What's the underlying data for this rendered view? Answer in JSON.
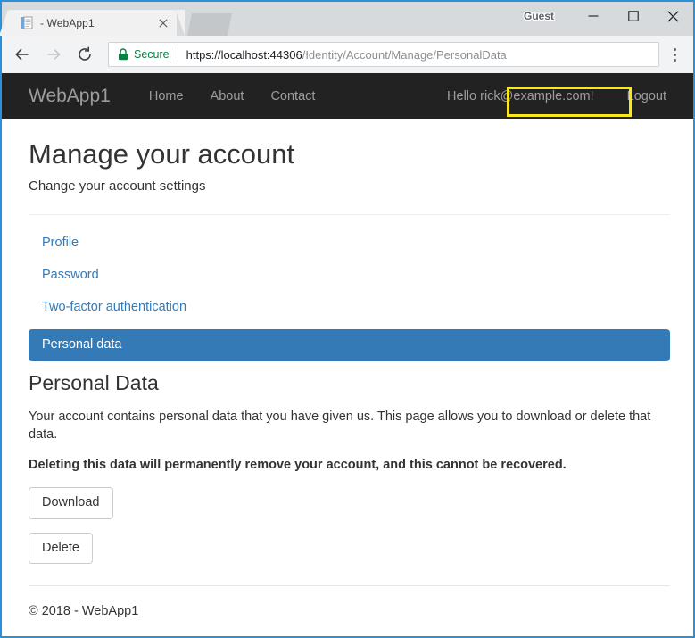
{
  "browser": {
    "tab": {
      "title": "- WebApp1",
      "favicon": "page-icon",
      "close": "×"
    },
    "window_controls": {
      "profile_label": "Guest",
      "minimize": "minimize-icon",
      "maximize": "maximize-icon",
      "close": "close-icon"
    },
    "toolbar": {
      "back": "back-arrow-icon",
      "forward": "forward-arrow-icon",
      "reload": "reload-icon",
      "security_label": "Secure",
      "lock": "lock-icon",
      "url_host": "https://localhost:44306",
      "url_path": "/Identity/Account/Manage/PersonalData",
      "url_full": "https://localhost:44306/Identity/Account/Manage/PersonalData",
      "menu": "three-dot-menu-icon"
    }
  },
  "site_nav": {
    "brand": "WebApp1",
    "links": [
      {
        "label": "Home"
      },
      {
        "label": "About"
      },
      {
        "label": "Contact"
      }
    ],
    "greeting_prefix": "Hello ",
    "user_email": "rick@example.com!",
    "logout": "Logout"
  },
  "page": {
    "title": "Manage your account",
    "subtitle": "Change your account settings",
    "side_nav": [
      {
        "label": "Profile",
        "active": false
      },
      {
        "label": "Password",
        "active": false
      },
      {
        "label": "Two-factor authentication",
        "active": false
      },
      {
        "label": "Personal data",
        "active": true
      }
    ],
    "section_title": "Personal Data",
    "paragraph": "Your account contains personal data that you have given us. This page allows you to download or delete that data.",
    "warning": "Deleting this data will permanently remove your account, and this cannot be recovered.",
    "download_button": "Download",
    "delete_button": "Delete",
    "footer": "© 2018 - WebApp1"
  },
  "colors": {
    "navbar_bg": "#222222",
    "nav_text": "#9d9d9d",
    "link_blue": "#337ab7",
    "active_pill_bg": "#337ab7",
    "highlight_yellow": "#f8e71c",
    "secure_green": "#0b8043",
    "window_border": "#2d8fd5"
  }
}
